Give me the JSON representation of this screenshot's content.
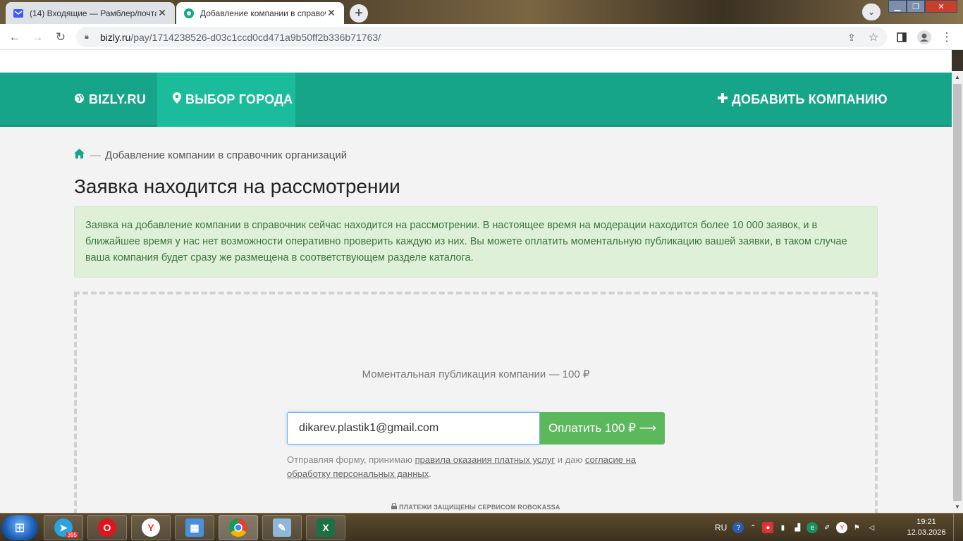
{
  "browser": {
    "tabs": [
      {
        "title": "(14) Входящие — Рамблер/почта",
        "active": false,
        "icon": "mail-icon"
      },
      {
        "title": "Добавление компании в справочник",
        "active": true,
        "icon": "bizly-favicon"
      }
    ],
    "new_tab": "+",
    "url_host": "bizly.ru",
    "url_path": "/pay/1714238526-d03c1ccd0cd471a9b50ff2b336b71763/"
  },
  "nav": {
    "brand": "BIZLY.RU",
    "city": "ВЫБОР ГОРОДА",
    "add_company": "ДОБАВИТЬ КОМПАНИЮ",
    "color": "#17a589"
  },
  "breadcrumb": {
    "separator": "—",
    "current": "Добавление компании в справочник организаций"
  },
  "page": {
    "title": "Заявка находится на рассмотрении",
    "alert": "Заявка на добавление компании в справочник сейчас находится на рассмотрении. В настоящее время на модерации находится более 10 000 заявок, и в ближайшее время у нас нет возможности оперативно проверить каждую из них. Вы можете оплатить моментальную публикацию вашей заявки, в таком случае ваша компания будет сразу же размещена в соответствующем разделе каталога."
  },
  "payment": {
    "caption": "Моментальная публикация компании — 100 ₽",
    "email_value": "dikarev.plastik1@gmail.com",
    "pay_button": "Оплатить 100 ₽ ⟶",
    "terms_prefix": "Отправляя форму, принимаю ",
    "terms_link1": "правила оказания платных услуг",
    "terms_middle": " и даю ",
    "terms_link2": "согласие на обработку персональных данных",
    "terms_suffix": ".",
    "secure_note": "ПЛАТЕЖИ ЗАЩИЩЕНЫ СЕРВИСОМ ROBOKASSA"
  },
  "taskbar": {
    "telegram_badge": "395",
    "lang": "RU",
    "time": "19:21",
    "date": "12.03.2026"
  }
}
